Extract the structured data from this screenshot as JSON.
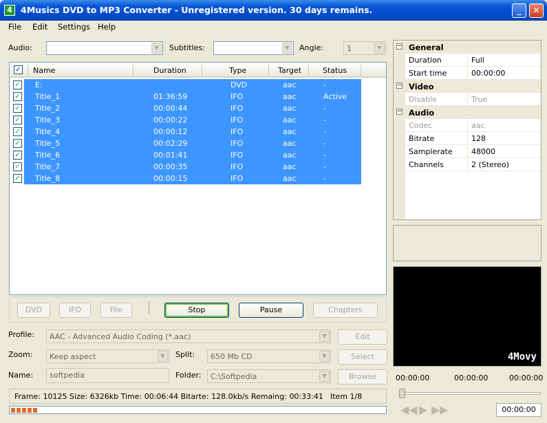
{
  "window": {
    "title": "4Musics DVD to MP3 Converter - Unregistered version. 30 days remains.",
    "icon_text": "4"
  },
  "menu": [
    "File",
    "Edit",
    "Settings",
    "Help"
  ],
  "top_controls": {
    "audio_label": "Audio:",
    "audio_value": "",
    "subtitles_label": "Subtitles:",
    "subtitles_value": "",
    "angle_label": "Angle:",
    "angle_value": "1"
  },
  "list": {
    "columns": [
      "Name",
      "Duration",
      "Type",
      "Target",
      "Status"
    ],
    "rows": [
      {
        "name": "E:",
        "duration": "",
        "type": "DVD",
        "target": "aac",
        "status": "-",
        "checked": true
      },
      {
        "name": "Title_1",
        "duration": "01:36:59",
        "type": "IFO",
        "target": "aac",
        "status": "Active",
        "checked": true
      },
      {
        "name": "Title_2",
        "duration": "00:00:44",
        "type": "IFO",
        "target": "aac",
        "status": "-",
        "checked": true
      },
      {
        "name": "Title_3",
        "duration": "00:00:22",
        "type": "IFO",
        "target": "aac",
        "status": "-",
        "checked": true
      },
      {
        "name": "Title_4",
        "duration": "00:00:12",
        "type": "IFO",
        "target": "aac",
        "status": "-",
        "checked": true
      },
      {
        "name": "Title_5",
        "duration": "00:02:29",
        "type": "IFO",
        "target": "aac",
        "status": "-",
        "checked": true
      },
      {
        "name": "Title_6",
        "duration": "00:01:41",
        "type": "IFO",
        "target": "aac",
        "status": "-",
        "checked": true
      },
      {
        "name": "Title_7",
        "duration": "00:00:35",
        "type": "IFO",
        "target": "aac",
        "status": "-",
        "checked": true
      },
      {
        "name": "Title_8",
        "duration": "00:00:15",
        "type": "IFO",
        "target": "aac",
        "status": "-",
        "checked": true
      }
    ]
  },
  "buttons": {
    "dvd": "DVD",
    "ifo": "IFO",
    "file": "File",
    "stop": "Stop",
    "pause": "Pause",
    "chapters": "Chapters",
    "edit": "Edit",
    "select": "Select",
    "browse": "Browse"
  },
  "bottom_fields": {
    "profile_label": "Profile:",
    "profile_value": "AAC - Advanced Audio Coding (*.aac)",
    "zoom_label": "Zoom:",
    "zoom_value": "Keep aspect",
    "split_label": "Split:",
    "split_value": "650 Mb CD",
    "name_label": "Name:",
    "name_value": "softpedia",
    "folder_label": "Folder:",
    "folder_value": "C:\\Softpedia"
  },
  "status": {
    "text": "Frame: 10125  Size: 6326kb  Time: 00:06:44  Bitarte: 128.0kb/s Remaing: 00:33:41",
    "item": "Item 1/8"
  },
  "progress": {
    "percent": 7
  },
  "properties": {
    "groups": [
      {
        "name": "General",
        "rows": [
          {
            "key": "Duration",
            "value": "Full",
            "enabled": true
          },
          {
            "key": "Start time",
            "value": "00:00:00",
            "enabled": true
          }
        ]
      },
      {
        "name": "Video",
        "rows": [
          {
            "key": "Disable",
            "value": "True",
            "enabled": false
          }
        ]
      },
      {
        "name": "Audio",
        "rows": [
          {
            "key": "Codec",
            "value": "aac",
            "enabled": false
          },
          {
            "key": "Bitrate",
            "value": "128",
            "enabled": true
          },
          {
            "key": "Samplerate",
            "value": "48000",
            "enabled": true
          },
          {
            "key": "Channels",
            "value": "2 (Stereo)",
            "enabled": true
          }
        ]
      }
    ]
  },
  "player": {
    "watermark": "4Movy",
    "time_start": "00:00:00",
    "time_mid": "00:00:00",
    "time_end": "00:00:00",
    "current_time": "00:00:00",
    "seek_fraction": 0
  },
  "colors": {
    "selection": "#3d95ff",
    "titlebar": "#0a55d8",
    "progress": "#e86a2c"
  }
}
